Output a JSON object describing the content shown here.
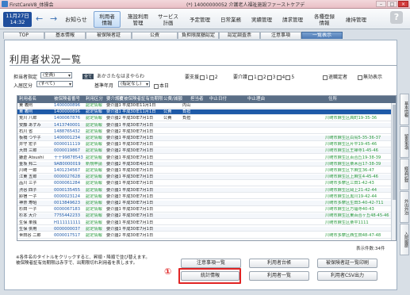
{
  "window": {
    "app_title": "FirstCareV8_体操会",
    "window_title": "(*) 14000000052 介護老人福祉施設ファーストケアデ",
    "min": "–",
    "max": "□",
    "close": "×"
  },
  "toolbar": {
    "date_line1": "11月27日",
    "date_line2": "14:32",
    "back_icon": "←",
    "forward_icon": "→",
    "notice": "お知らせ",
    "buttons": [
      {
        "label": "利用者\n情報",
        "active": true
      },
      {
        "label": "施設利用\n管理",
        "active": false
      },
      {
        "label": "サービス\n計画",
        "active": false
      },
      {
        "label": "予定管理",
        "active": false
      },
      {
        "label": "日常業務",
        "active": false
      },
      {
        "label": "実績管理",
        "active": false
      },
      {
        "label": "請求管理",
        "active": false
      },
      {
        "label": "各種登録\n情報",
        "active": false
      },
      {
        "label": "維持管理",
        "active": false
      }
    ],
    "help": "?"
  },
  "tabs": [
    {
      "label": "TOP",
      "active": false
    },
    {
      "label": "基本情報",
      "active": false
    },
    {
      "label": "被保険者証",
      "active": false
    },
    {
      "label": "公費",
      "active": false
    },
    {
      "label": "負担限度額認定",
      "active": false
    },
    {
      "label": "認定調査票",
      "active": false
    },
    {
      "label": "注意事項",
      "active": false
    },
    {
      "label": "一覧表示",
      "active": true
    }
  ],
  "page": {
    "title": "利用者状況一覧"
  },
  "filters": {
    "building_label": "担当者指定",
    "building_value": "(全員)",
    "kana_badge": "全て",
    "kana_row": "あかさたなはまやらわ",
    "gender_label": "要支援",
    "care_label": "要介護",
    "levels": [
      "1",
      "2",
      "3",
      "4",
      "5"
    ],
    "deceased": "退職定者",
    "invalid": "無効表示",
    "entry_label": "入居区分",
    "entry_value": "(すべて)",
    "date_label": "基準年月",
    "date_value": "(指定なし)",
    "today": "本日"
  },
  "table": {
    "headers": [
      "利用者名",
      "被保険者番号",
      "利用区分",
      "要介護度",
      "被",
      "被保険者証有効期限",
      "公費/減額",
      "担当者",
      "中止日付",
      "中止理由",
      "住所"
    ],
    "rows": [
      {
        "name": "東 義則",
        "id": "1400000896",
        "cat": "認定情報",
        "status": "要介護1",
        "date": "平成30年11月1日",
        "note": "",
        "staff": "内山",
        "addr": "",
        "sel": false
      },
      {
        "name": "東 義則",
        "id": "1400000896",
        "cat": "認定情報",
        "status": "要介護1",
        "date": "平成30年11月1日",
        "note": "公費",
        "staff": "負担",
        "addr": "",
        "sel": true
      },
      {
        "name": "荒川 八郎",
        "id": "1400067876",
        "cat": "認定情報",
        "status": "要介護2",
        "date": "平成30年7月1日",
        "note": "公費",
        "staff": "負担",
        "addr": "川崎市麻生区高町19-35-36",
        "sel": false
      },
      {
        "name": "安藤 あずみ",
        "id": "1413740001",
        "cat": "認定情報",
        "status": "要介護1",
        "date": "平成30年7月1日",
        "note": "",
        "staff": "",
        "addr": "",
        "sel": false
      },
      {
        "name": "石川 省",
        "id": "1488765432",
        "cat": "認定情報",
        "status": "要介護2",
        "date": "平成30年7月1日",
        "note": "",
        "staff": "",
        "addr": "",
        "sel": false
      },
      {
        "name": "板橋 つや子",
        "id": "1400001234",
        "cat": "認定情報",
        "status": "要介護1",
        "date": "平成30年7月1日",
        "note": "",
        "staff": "",
        "addr": "川崎市麻生区白鳥5-35-36-37",
        "sel": false
      },
      {
        "name": "井守 宏子",
        "id": "0000011119",
        "cat": "認定情報",
        "status": "要介護1",
        "date": "平成30年7月1日",
        "note": "",
        "staff": "",
        "addr": "川崎市麻生区片平19-45-46",
        "sel": false
      },
      {
        "name": "大田 三郎",
        "id": "0000019867",
        "cat": "認定情報",
        "status": "要介護2",
        "date": "平成30年7月1日",
        "note": "",
        "staff": "",
        "addr": "川崎市麻生区王禅寺1-45-46",
        "sel": false
      },
      {
        "name": "鎌倉 Atsushi",
        "id": "十十99878543",
        "cat": "認定情報",
        "status": "要介護1",
        "date": "平成30年7月1日",
        "note": "",
        "staff": "",
        "addr": "川崎市麻生区百合丘19-38-39",
        "sel": false
      },
      {
        "name": "金坂 邦二",
        "id": "9AB0000019",
        "cat": "新規申請",
        "status": "要介護2",
        "date": "平成30年4月1日",
        "note": "",
        "staff": "",
        "addr": "川崎市麻生区栗木台17-38-39",
        "sel": false
      },
      {
        "name": "川崎 一郎",
        "id": "1401234567",
        "cat": "認定情報",
        "status": "要介護1",
        "date": "平成30年7月1日",
        "note": "",
        "staff": "",
        "addr": "川崎市麻生区下麻生36-47",
        "sel": false
      },
      {
        "name": "江東 五郎",
        "id": "0000027628",
        "cat": "認定情報",
        "status": "要介護1",
        "date": "平成30年7月1日",
        "note": "",
        "staff": "",
        "addr": "川崎市麻生区上麻生4-45-46",
        "sel": false
      },
      {
        "name": "品川 三子",
        "id": "0000061284",
        "cat": "認定情報",
        "status": "要介護1",
        "date": "平成30年7月1日",
        "note": "",
        "staff": "",
        "addr": "川崎市多摩区三田1-42-43",
        "sel": false
      },
      {
        "name": "渋谷 四子",
        "id": "0000135455",
        "cat": "認定情報",
        "status": "要介護1",
        "date": "平成30年7月1日",
        "note": "",
        "staff": "",
        "addr": "川崎市麻生区岡上21-42-44",
        "sel": false
      },
      {
        "name": "鈴宿 一子",
        "id": "0000023124",
        "cat": "認定情報",
        "status": "要介護3",
        "date": "平成30年7月1日",
        "note": "",
        "staff": "",
        "addr": "川崎市麻生区黒川19-42-44",
        "sel": false
      },
      {
        "name": "神奈 寿昭",
        "id": "0013849623",
        "cat": "認定情報",
        "status": "要介護2",
        "date": "平成30年7月1日",
        "note": "",
        "staff": "",
        "addr": "川崎市多摩区生田3-40-42-711",
        "sel": false
      },
      {
        "name": "杉田 一子",
        "id": "0000067183",
        "cat": "認定情報",
        "status": "要介護1",
        "date": "平成30年7月1日",
        "note": "",
        "staff": "",
        "addr": "川崎市麻生区万福寺40-43",
        "sel": false
      },
      {
        "name": "杉本 大介",
        "id": "7755442233",
        "cat": "認定情報",
        "status": "要介護2",
        "date": "平成30年7月1日",
        "note": "",
        "staff": "",
        "addr": "川崎市麻生区東百合ヶ丘48-45-46",
        "sel": false
      },
      {
        "name": "生保 単独",
        "id": "H111111111",
        "cat": "認定情報",
        "status": "要介護1",
        "date": "平成30年7月1日",
        "note": "",
        "staff": "",
        "addr": "川崎市麻生区栗平1111",
        "sel": false
      },
      {
        "name": "生保 併用",
        "id": "0000000037",
        "cat": "認定情報",
        "status": "要介護1",
        "date": "平成30年7月1日",
        "note": "",
        "staff": "",
        "addr": "",
        "sel": false
      },
      {
        "name": "世田谷 二郎",
        "id": "0000017517",
        "cat": "認定情報",
        "status": "要介護2",
        "date": "平成30年7月1日",
        "note": "",
        "staff": "",
        "addr": "川崎市多摩区西生田48-47-48",
        "sel": false
      }
    ]
  },
  "count": "表示件数:34件",
  "note": {
    "line1": "※各件名のタイトルをクリックすると、昇順・降順で並び替えます。",
    "line2": "被保険者証有効期限は赤字で、出期限切れ利用者を表します。"
  },
  "buttons": {
    "caution_list": "注意事項一覧",
    "user_register": "利用者台帳",
    "insurance_list": "被保険者証一覧印刷",
    "stats": "統計情報",
    "user_list": "利用者一覧",
    "csv": "利用者CSV出力"
  },
  "annotation": {
    "marker": "①"
  },
  "side_tabs": [
    "基本情報",
    "留意事項",
    "経過記録",
    "外出外泊",
    "入院履歴"
  ]
}
